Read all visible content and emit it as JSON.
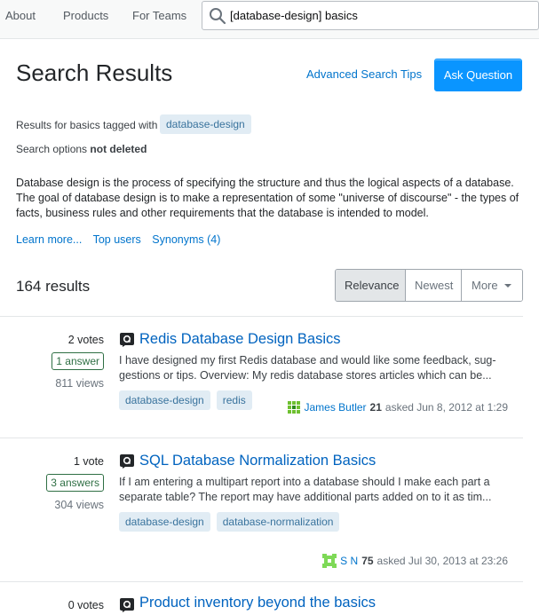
{
  "nav": {
    "about": "About",
    "products": "Products",
    "teams": "For Teams",
    "search_value": "[database-design] basics"
  },
  "header": {
    "title": "Search Results",
    "advanced_tips": "Advanced Search Tips",
    "ask_button": "Ask Question",
    "results_for_prefix": "Results for basics tagged with",
    "results_for_tag": "database-design",
    "search_options_prefix": "Search options",
    "search_options_value": "not deleted"
  },
  "tag_info": {
    "excerpt": "Database design is the process of specifying the structure and thus the logical aspects of a database. The goal of database design is to make a representation of some \"universe of discourse\" - the types of facts, business rules and other requirements that the database is intended to model.",
    "links": [
      "Learn more...",
      "Top users",
      "Synonyms (4)"
    ]
  },
  "results_bar": {
    "count": "164 results",
    "sort": [
      "Relevance",
      "Newest",
      "More"
    ]
  },
  "colors": {
    "accent": "#0a95ff",
    "link": "#0074cc",
    "tag_bg": "#e1ecf4",
    "tag_fg": "#39739d",
    "answered_border": "#2f6f44"
  },
  "results": [
    {
      "votes": "2 votes",
      "answers": "1 answer",
      "views": "811 views",
      "title": "Redis Database Design Basics",
      "excerpt_1": "I have designed my first Redis database and would like some feedback, sug-",
      "excerpt_2": "gestions or tips. Overview: My redis database stores articles which can be...",
      "tags": [
        "database-design",
        "redis"
      ],
      "user": "James Butler",
      "rep": "21",
      "asked": "asked Jun 8, 2012 at 1:29"
    },
    {
      "votes": "1 vote",
      "answers": "3 answers",
      "views": "304 views",
      "title": "SQL Database Normalization Basics",
      "excerpt_1": "If I am entering a multipart report into a database should I make each part a",
      "excerpt_2": "separate table? The report may have additional parts added on to it as tim...",
      "tags": [
        "database-design",
        "database-normalization"
      ],
      "user": "S N",
      "rep": "75",
      "asked": "asked Jul 30, 2013 at 23:26"
    },
    {
      "votes": "0 votes",
      "title": "Product inventory beyond the basics"
    }
  ]
}
